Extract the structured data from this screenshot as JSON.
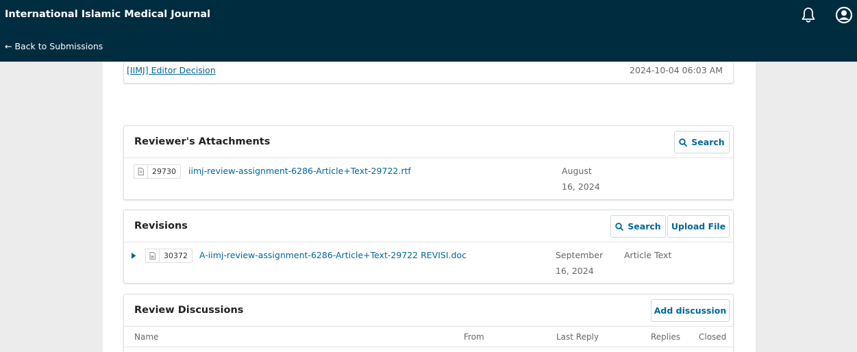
{
  "header": {
    "journal_title": "International Islamic Medical Journal",
    "back_link": "← Back to Submissions"
  },
  "notification": {
    "subject": "[IIMJ] Editor Decision",
    "date": "2024-10-04 06:03 AM"
  },
  "reviewer_attachments": {
    "title": "Reviewer's Attachments",
    "search_label": "Search",
    "files": [
      {
        "id": "29730",
        "name": "iimj-review-assignment-6286-Article+Text-29722.rtf",
        "date_line1": "August",
        "date_line2": "16, 2024"
      }
    ]
  },
  "revisions": {
    "title": "Revisions",
    "search_label": "Search",
    "upload_label": "Upload File",
    "files": [
      {
        "id": "30372",
        "name": "A-iimj-review-assignment-6286-Article+Text-29722 REVISI.doc",
        "date_line1": "September",
        "date_line2": "16, 2024",
        "type": "Article Text"
      }
    ]
  },
  "review_discussions": {
    "title": "Review Discussions",
    "add_label": "Add discussion",
    "columns": [
      "Name",
      "From",
      "Last Reply",
      "Replies",
      "Closed"
    ]
  },
  "colors": {
    "header_bg": "#002c40",
    "link": "#006798",
    "page_bg": "#ececec"
  }
}
